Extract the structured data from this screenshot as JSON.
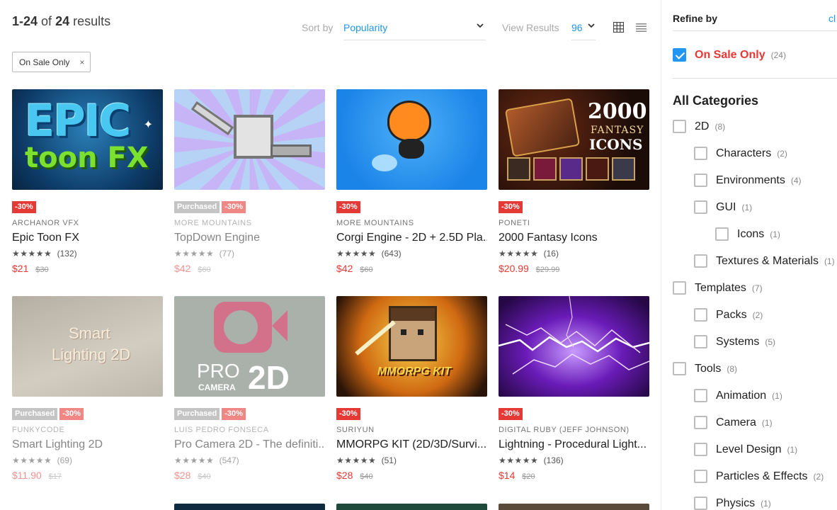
{
  "header": {
    "results_range": "1-24",
    "results_of": "of",
    "results_total": "24",
    "results_word": "results",
    "sort_label": "Sort by",
    "sort_value": "Popularity",
    "view_label": "View Results",
    "view_value": "96"
  },
  "filter_chip": {
    "label": "On Sale Only",
    "close": "×"
  },
  "products": [
    {
      "publisher": "ARCHANOR VFX",
      "title": "Epic Toon FX",
      "stars": "★★★★★",
      "reviews": "(132)",
      "price": "$21",
      "old_price": "$30",
      "badges": [
        "-30%"
      ],
      "purchased": false,
      "thumb_text": [
        "EPIC",
        "toon FX"
      ]
    },
    {
      "publisher": "MORE MOUNTAINS",
      "title": "TopDown Engine",
      "stars": "★★★★★",
      "reviews": "(77)",
      "price": "$42",
      "old_price": "$60",
      "badges": [
        "Purchased",
        "-30%"
      ],
      "purchased": true,
      "thumb_text": []
    },
    {
      "publisher": "MORE MOUNTAINS",
      "title": "Corgi Engine - 2D + 2.5D Pla...",
      "stars": "★★★★★",
      "reviews": "(643)",
      "price": "$42",
      "old_price": "$60",
      "badges": [
        "-30%"
      ],
      "purchased": false,
      "thumb_text": []
    },
    {
      "publisher": "PONETI",
      "title": "2000 Fantasy Icons",
      "stars": "★★★★★",
      "reviews": "(16)",
      "price": "$20.99",
      "old_price": "$29.99",
      "badges": [
        "-30%"
      ],
      "purchased": false,
      "thumb_text": [
        "2000",
        "FANTASY",
        "ICONS"
      ]
    },
    {
      "publisher": "FUNKYCODE",
      "title": "Smart Lighting 2D",
      "stars": "★★★★★",
      "reviews": "(69)",
      "price": "$11.90",
      "old_price": "$17",
      "badges": [
        "Purchased",
        "-30%"
      ],
      "purchased": true,
      "thumb_text": [
        "Smart",
        "Lighting 2D"
      ]
    },
    {
      "publisher": "LUIS PEDRO FONSECA",
      "title": "Pro Camera 2D - The definiti...",
      "stars": "★★★★★",
      "reviews": "(547)",
      "price": "$28",
      "old_price": "$40",
      "badges": [
        "Purchased",
        "-30%"
      ],
      "purchased": true,
      "thumb_text": [
        "PRO",
        "CAMERA",
        "2D"
      ]
    },
    {
      "publisher": "SURIYUN",
      "title": "MMORPG KIT (2D/3D/Survi...",
      "stars": "★★★★★",
      "reviews": "(51)",
      "price": "$28",
      "old_price": "$40",
      "badges": [
        "-30%"
      ],
      "purchased": false,
      "thumb_text": [
        "MMORPG KIT"
      ]
    },
    {
      "publisher": "DIGITAL RUBY (JEFF JOHNSON)",
      "title": "Lightning - Procedural Light...",
      "stars": "★★★★★",
      "reviews": "(136)",
      "price": "$14",
      "old_price": "$20",
      "badges": [
        "-30%"
      ],
      "purchased": false,
      "thumb_text": []
    }
  ],
  "sidebar": {
    "refine_label": "Refine by",
    "clear_label": "cl",
    "on_sale": {
      "label": "On Sale Only",
      "count": "(24)",
      "checked": true
    },
    "categories_title": "All Categories",
    "categories": [
      {
        "label": "2D",
        "count": "(8)",
        "level": 0
      },
      {
        "label": "Characters",
        "count": "(2)",
        "level": 1
      },
      {
        "label": "Environments",
        "count": "(4)",
        "level": 1
      },
      {
        "label": "GUI",
        "count": "(1)",
        "level": 1
      },
      {
        "label": "Icons",
        "count": "(1)",
        "level": 2
      },
      {
        "label": "Textures & Materials",
        "count": "(1)",
        "level": 1
      },
      {
        "label": "Templates",
        "count": "(7)",
        "level": 0
      },
      {
        "label": "Packs",
        "count": "(2)",
        "level": 1
      },
      {
        "label": "Systems",
        "count": "(5)",
        "level": 1
      },
      {
        "label": "Tools",
        "count": "(8)",
        "level": 0
      },
      {
        "label": "Animation",
        "count": "(1)",
        "level": 1
      },
      {
        "label": "Camera",
        "count": "(1)",
        "level": 1
      },
      {
        "label": "Level Design",
        "count": "(1)",
        "level": 1
      },
      {
        "label": "Particles & Effects",
        "count": "(2)",
        "level": 1
      },
      {
        "label": "Physics",
        "count": "(1)",
        "level": 1
      }
    ]
  },
  "colors": {
    "accent": "#2196f3",
    "sale": "#e53935",
    "badge_gray": "#9e9e9e"
  }
}
